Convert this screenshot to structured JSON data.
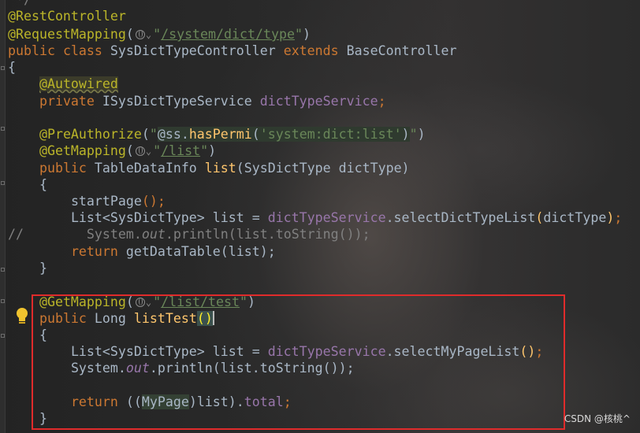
{
  "editor": {
    "lines": {
      "l0": {
        "comment": " */"
      },
      "l1": {
        "ann": "@RestController"
      },
      "l2": {
        "ann": "@RequestMapping",
        "open": "(",
        "q1": "\"",
        "path": "/system/dict/type",
        "q2": "\"",
        "close": ")"
      },
      "l3": {
        "kw1": "public",
        "kw2": "class",
        "name": "SysDictTypeController",
        "kw3": "extends",
        "base": "BaseController"
      },
      "l4": {
        "text": "{"
      },
      "l5": {
        "ann": "@Autowired"
      },
      "l6": {
        "kw": "private",
        "type": "ISysDictTypeService",
        "field": "dictTypeService",
        "semi": ";"
      },
      "l8": {
        "ann": "@PreAuthorize",
        "open": "(",
        "q1": "\"",
        "inj1": "@ss.",
        "inj_fn": "hasPermi",
        "inj2": "(",
        "inj_str": "'system:dict:list'",
        "inj3": ")",
        "q2": "\"",
        "close": ")"
      },
      "l9": {
        "ann": "@GetMapping",
        "open": "(",
        "q1": "\"",
        "path": "/list",
        "q2": "\"",
        "close": ")"
      },
      "l10": {
        "kw": "public",
        "type": "TableDataInfo",
        "fn": "list",
        "params": "(SysDictType dictType)"
      },
      "l11": {
        "text": "{"
      },
      "l12": {
        "fn": "startPage",
        "rest": "();"
      },
      "l13": {
        "p1": "List<SysDictType> list = ",
        "field": "dictTypeService",
        "p2": ".selectDictTypeList",
        "o": "(",
        "arg": "dictType",
        "c": ")",
        "s": ";"
      },
      "l14": {
        "marker": "//",
        "p1": "System.",
        "out": "out",
        "p2": ".println(list.toString());"
      },
      "l15": {
        "kw": "return",
        "p1": " getDataTable(list);"
      },
      "l16": {
        "text": "}"
      },
      "l18": {
        "ann": "@GetMapping",
        "open": "(",
        "q1": "\"",
        "path": "/list/test",
        "q2": "\"",
        "close": ")"
      },
      "l19": {
        "kw": "public",
        "type": "Long",
        "fn": "listTest",
        "parens": "()"
      },
      "l20": {
        "text": "{"
      },
      "l21": {
        "p1": "List<SysDictType> list = ",
        "field": "dictTypeService",
        "p2": ".selectMyPageList",
        "o": "(",
        "c": ")",
        "s": ";"
      },
      "l22": {
        "p1": "System.",
        "out": "out",
        "p2": ".println(list.toString());"
      },
      "l24": {
        "kw": "return",
        "p0": " ((",
        "cast": "MyPage",
        "p1": ")list).",
        "field": "total",
        "s": ";"
      },
      "l25": {
        "text": "}"
      }
    }
  },
  "watermark": "CSDN @核桃^",
  "colors": {
    "background": "#2b2b2b",
    "keyword": "#cc7832",
    "annotation": "#bbb529",
    "string": "#6a8759",
    "field": "#9876aa",
    "function": "#ffc66d",
    "default_text": "#a9b7c6",
    "highlight_box": "#e02b2b"
  },
  "icons": [
    "globe-icon",
    "chevron-down-icon",
    "lightbulb-icon"
  ]
}
